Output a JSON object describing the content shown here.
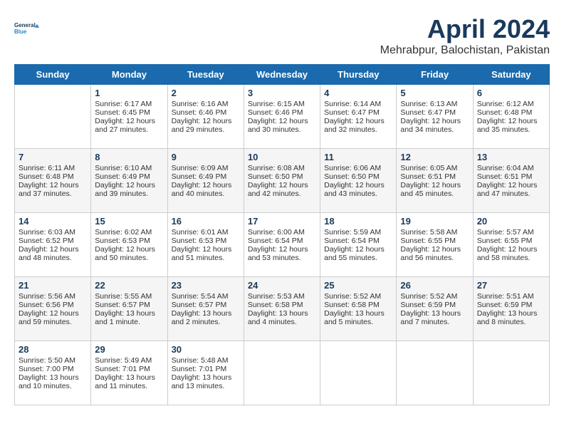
{
  "header": {
    "logo_line1": "General",
    "logo_line2": "Blue",
    "month": "April 2024",
    "location": "Mehrabpur, Balochistan, Pakistan"
  },
  "days_of_week": [
    "Sunday",
    "Monday",
    "Tuesday",
    "Wednesday",
    "Thursday",
    "Friday",
    "Saturday"
  ],
  "weeks": [
    [
      {
        "day": "",
        "info": ""
      },
      {
        "day": "1",
        "info": "Sunrise: 6:17 AM\nSunset: 6:45 PM\nDaylight: 12 hours\nand 27 minutes."
      },
      {
        "day": "2",
        "info": "Sunrise: 6:16 AM\nSunset: 6:46 PM\nDaylight: 12 hours\nand 29 minutes."
      },
      {
        "day": "3",
        "info": "Sunrise: 6:15 AM\nSunset: 6:46 PM\nDaylight: 12 hours\nand 30 minutes."
      },
      {
        "day": "4",
        "info": "Sunrise: 6:14 AM\nSunset: 6:47 PM\nDaylight: 12 hours\nand 32 minutes."
      },
      {
        "day": "5",
        "info": "Sunrise: 6:13 AM\nSunset: 6:47 PM\nDaylight: 12 hours\nand 34 minutes."
      },
      {
        "day": "6",
        "info": "Sunrise: 6:12 AM\nSunset: 6:48 PM\nDaylight: 12 hours\nand 35 minutes."
      }
    ],
    [
      {
        "day": "7",
        "info": "Sunrise: 6:11 AM\nSunset: 6:48 PM\nDaylight: 12 hours\nand 37 minutes."
      },
      {
        "day": "8",
        "info": "Sunrise: 6:10 AM\nSunset: 6:49 PM\nDaylight: 12 hours\nand 39 minutes."
      },
      {
        "day": "9",
        "info": "Sunrise: 6:09 AM\nSunset: 6:49 PM\nDaylight: 12 hours\nand 40 minutes."
      },
      {
        "day": "10",
        "info": "Sunrise: 6:08 AM\nSunset: 6:50 PM\nDaylight: 12 hours\nand 42 minutes."
      },
      {
        "day": "11",
        "info": "Sunrise: 6:06 AM\nSunset: 6:50 PM\nDaylight: 12 hours\nand 43 minutes."
      },
      {
        "day": "12",
        "info": "Sunrise: 6:05 AM\nSunset: 6:51 PM\nDaylight: 12 hours\nand 45 minutes."
      },
      {
        "day": "13",
        "info": "Sunrise: 6:04 AM\nSunset: 6:51 PM\nDaylight: 12 hours\nand 47 minutes."
      }
    ],
    [
      {
        "day": "14",
        "info": "Sunrise: 6:03 AM\nSunset: 6:52 PM\nDaylight: 12 hours\nand 48 minutes."
      },
      {
        "day": "15",
        "info": "Sunrise: 6:02 AM\nSunset: 6:53 PM\nDaylight: 12 hours\nand 50 minutes."
      },
      {
        "day": "16",
        "info": "Sunrise: 6:01 AM\nSunset: 6:53 PM\nDaylight: 12 hours\nand 51 minutes."
      },
      {
        "day": "17",
        "info": "Sunrise: 6:00 AM\nSunset: 6:54 PM\nDaylight: 12 hours\nand 53 minutes."
      },
      {
        "day": "18",
        "info": "Sunrise: 5:59 AM\nSunset: 6:54 PM\nDaylight: 12 hours\nand 55 minutes."
      },
      {
        "day": "19",
        "info": "Sunrise: 5:58 AM\nSunset: 6:55 PM\nDaylight: 12 hours\nand 56 minutes."
      },
      {
        "day": "20",
        "info": "Sunrise: 5:57 AM\nSunset: 6:55 PM\nDaylight: 12 hours\nand 58 minutes."
      }
    ],
    [
      {
        "day": "21",
        "info": "Sunrise: 5:56 AM\nSunset: 6:56 PM\nDaylight: 12 hours\nand 59 minutes."
      },
      {
        "day": "22",
        "info": "Sunrise: 5:55 AM\nSunset: 6:57 PM\nDaylight: 13 hours\nand 1 minute."
      },
      {
        "day": "23",
        "info": "Sunrise: 5:54 AM\nSunset: 6:57 PM\nDaylight: 13 hours\nand 2 minutes."
      },
      {
        "day": "24",
        "info": "Sunrise: 5:53 AM\nSunset: 6:58 PM\nDaylight: 13 hours\nand 4 minutes."
      },
      {
        "day": "25",
        "info": "Sunrise: 5:52 AM\nSunset: 6:58 PM\nDaylight: 13 hours\nand 5 minutes."
      },
      {
        "day": "26",
        "info": "Sunrise: 5:52 AM\nSunset: 6:59 PM\nDaylight: 13 hours\nand 7 minutes."
      },
      {
        "day": "27",
        "info": "Sunrise: 5:51 AM\nSunset: 6:59 PM\nDaylight: 13 hours\nand 8 minutes."
      }
    ],
    [
      {
        "day": "28",
        "info": "Sunrise: 5:50 AM\nSunset: 7:00 PM\nDaylight: 13 hours\nand 10 minutes."
      },
      {
        "day": "29",
        "info": "Sunrise: 5:49 AM\nSunset: 7:01 PM\nDaylight: 13 hours\nand 11 minutes."
      },
      {
        "day": "30",
        "info": "Sunrise: 5:48 AM\nSunset: 7:01 PM\nDaylight: 13 hours\nand 13 minutes."
      },
      {
        "day": "",
        "info": ""
      },
      {
        "day": "",
        "info": ""
      },
      {
        "day": "",
        "info": ""
      },
      {
        "day": "",
        "info": ""
      }
    ]
  ]
}
